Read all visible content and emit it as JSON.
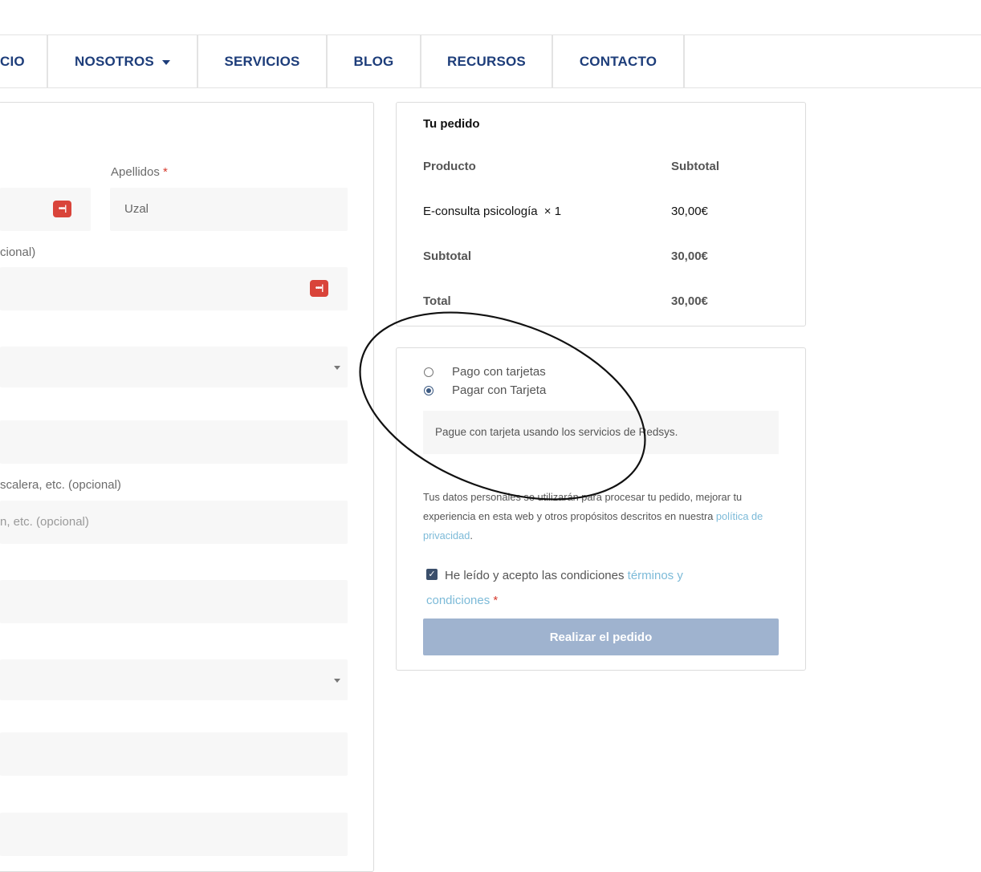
{
  "nav": {
    "items": [
      {
        "label": "CIO"
      },
      {
        "label": "NOSOTROS"
      },
      {
        "label": "SERVICIOS"
      },
      {
        "label": "BLOG"
      },
      {
        "label": "RECURSOS"
      },
      {
        "label": "CONTACTO"
      }
    ]
  },
  "form": {
    "apellidos_label": "Apellidos",
    "required_mark": "*",
    "apellidos_value": "Uzal",
    "company_label_fragment": "cional)",
    "address2_label_fragment": "scalera, etc. (opcional)",
    "address2_placeholder_fragment": "n, etc. (opcional)"
  },
  "order": {
    "title": "Tu pedido",
    "col_product": "Producto",
    "col_subtotal": "Subtotal",
    "item_name": "E-consulta psicología",
    "item_qty": "× 1",
    "item_price": "30,00€",
    "subtotal_label": "Subtotal",
    "subtotal_value": "30,00€",
    "total_label": "Total",
    "total_value": "30,00€"
  },
  "payment": {
    "option1": "Pago con tarjetas",
    "option2": "Pagar con Tarjeta",
    "selected": 2,
    "description": "Pague con tarjeta usando los servicios de Redsys.",
    "privacy_text": "Tus datos personales se utilizarán para procesar tu pedido, mejorar tu experiencia en esta web y otros propósitos descritos en nuestra",
    "privacy_link": "política de privacidad",
    "privacy_end": ".",
    "terms_text": "He leído y acepto las condiciones",
    "terms_link": "términos y condiciones",
    "terms_checked": true,
    "place_order": "Realizar el pedido"
  },
  "colors": {
    "nav_text": "#1d3d7a",
    "link": "#7cbad8",
    "button": "#9fb3cf",
    "required": "#d63a2d",
    "password_icon": "#d9443a"
  }
}
